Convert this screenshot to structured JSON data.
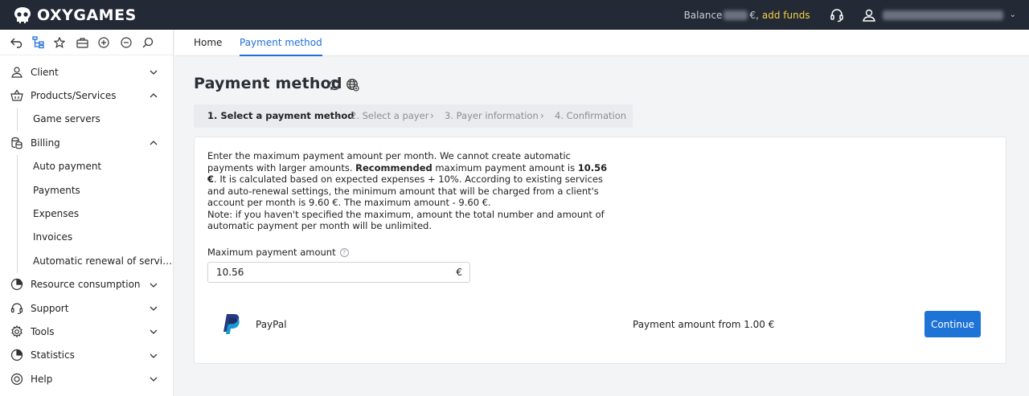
{
  "header": {
    "brand": "OXYGAMES",
    "balance_label": "Balance",
    "currency_suffix": "€,",
    "add_funds": "add funds"
  },
  "sidebar": {
    "toolbar": [
      "back-icon",
      "tree-icon",
      "star-icon",
      "briefcase-icon",
      "plus-circle-icon",
      "minus-circle-icon",
      "search-icon"
    ],
    "items": {
      "client": "Client",
      "products": "Products/Services",
      "game_servers": "Game servers",
      "billing": "Billing",
      "auto_payment": "Auto payment",
      "payments": "Payments",
      "expenses": "Expenses",
      "invoices": "Invoices",
      "auto_renewal": "Automatic renewal of servi…",
      "resource": "Resource consumption",
      "support": "Support",
      "tools": "Tools",
      "statistics": "Statistics",
      "help": "Help"
    }
  },
  "tabs": {
    "home": "Home",
    "payment_method": "Payment method"
  },
  "main": {
    "title": "Payment method",
    "steps": [
      "1. Select a payment method",
      "2. Select a payer",
      "3. Payer information",
      "4. Confirmation"
    ],
    "desc": {
      "p1": "Enter the maximum payment amount per month. We cannot create automatic payments with larger amounts. ",
      "recommended": "Recommended",
      "p2": " maximum payment amount is ",
      "amount_bold": "10.56 €",
      "p3": ". It is calculated based on expected expenses + 10%. According to existing services and auto-renewal settings, the minimum amount that will be charged from a client's account per month is 9.60 €. The maximum amount - 9.60 €.",
      "note": "Note: if you haven't specified the maximum, amount the total number and amount of automatic payment per month will be unlimited."
    },
    "field_label": "Maximum payment amount",
    "field_value": "10.56",
    "field_currency": "€",
    "payment": {
      "name": "PayPal",
      "amount_text": "Payment amount from 1.00 €",
      "button": "Continue"
    }
  },
  "colors": {
    "topbar": "#232a36",
    "accent": "#1e6fd9",
    "add_funds": "#f5d142",
    "paypal_dark": "#253b80",
    "paypal_light": "#179bd7"
  }
}
